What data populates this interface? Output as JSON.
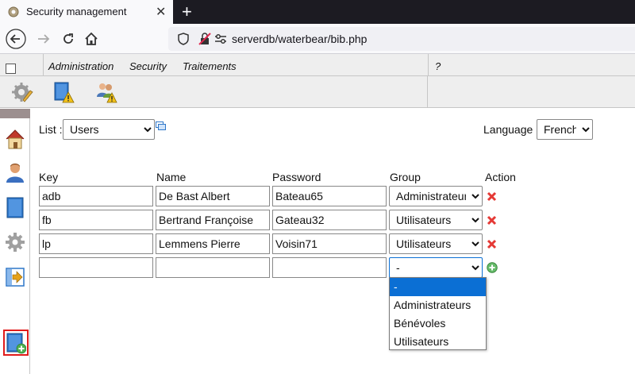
{
  "browser": {
    "tab_title": "Security management",
    "new_tab_glyph": "+",
    "url_host": "serverdb",
    "url_path": "/waterbear/bib.php"
  },
  "menu": {
    "items": [
      "Administration",
      "Security",
      "Traitements"
    ],
    "help": "?"
  },
  "toolbar": {
    "icons": [
      "settings-edit-icon",
      "book-warning-icon",
      "users-warning-icon"
    ]
  },
  "sidebar": {
    "icons": [
      "home-icon",
      "user-icon",
      "book-icon",
      "gear-icon",
      "import-icon",
      "add-book-icon"
    ]
  },
  "list": {
    "label": "List :",
    "selected": "Users"
  },
  "language": {
    "label": "Language :",
    "selected": "French"
  },
  "table": {
    "headers": [
      "Key",
      "Name",
      "Password",
      "Group",
      "Action"
    ],
    "rows": [
      {
        "key": "adb",
        "name": "De Bast Albert",
        "password": "Bateau65",
        "group": "Administrateurs"
      },
      {
        "key": "fb",
        "name": "Bertrand Françoise",
        "password": "Gateau32",
        "group": "Utilisateurs"
      },
      {
        "key": "lp",
        "name": "Lemmens Pierre",
        "password": "Voisin71",
        "group": "Utilisateurs"
      }
    ],
    "new_row": {
      "key": "",
      "name": "",
      "password": "",
      "group": "-"
    }
  },
  "group_dropdown": {
    "options": [
      "-",
      "Administrateurs",
      "Bénévoles",
      "Utilisateurs"
    ],
    "selected": "-"
  },
  "colors": {
    "accent": "#0b6fd4",
    "delete": "#e53935",
    "add": "#4caf50",
    "selection_border": "#e01b1b"
  }
}
